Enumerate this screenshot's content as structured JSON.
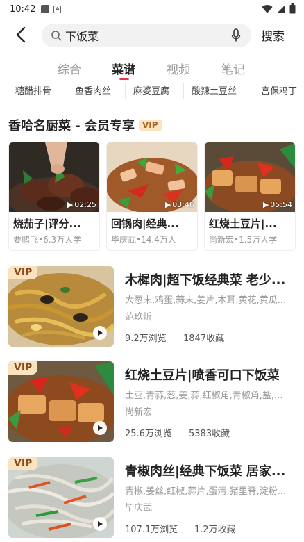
{
  "status_bar": {
    "time": "10:42",
    "icons": [
      "notification-icon",
      "a-icon",
      "wifi-icon",
      "signal-icon",
      "battery-icon"
    ]
  },
  "search": {
    "query": "下饭菜",
    "button_label": "搜索"
  },
  "tabs": [
    {
      "label": "综合",
      "active": false
    },
    {
      "label": "菜谱",
      "active": true
    },
    {
      "label": "视频",
      "active": false
    },
    {
      "label": "笔记",
      "active": false
    }
  ],
  "chips": [
    "糖醋排骨",
    "鱼香肉丝",
    "麻婆豆腐",
    "酸辣土豆丝",
    "宫保鸡丁"
  ],
  "vip_section": {
    "title": "香哈名厨菜 - 会员专享",
    "badge": "VIP",
    "cards": [
      {
        "title": "烧茄子|评分...",
        "author": "要鹏飞",
        "views": "6.3万人学",
        "duration": "02:25"
      },
      {
        "title": "回锅肉|经典...",
        "author": "毕庆武",
        "views": "14.4万人",
        "duration": "03:46"
      },
      {
        "title": "红烧土豆片|...",
        "author": "尚新宏",
        "views": "1.5万人学",
        "duration": "05:54"
      }
    ]
  },
  "recipes": [
    {
      "vip": "VIP",
      "title": "木樨肉|超下饭经典菜 老少...",
      "ingredients": "大葱末,鸡蛋,蒜末,姜片,木耳,黄花,黄瓜...",
      "author": "范玖炘",
      "views": "9.2万浏览",
      "favorites": "1847收藏"
    },
    {
      "vip": "VIP",
      "title": "红烧土豆片|喷香可口下饭菜",
      "ingredients": "土豆,青蒜,葱,姜,蒜,红椒角,青椒角,盐,...",
      "author": "尚新宏",
      "views": "25.6万浏览",
      "favorites": "5383收藏"
    },
    {
      "vip": "VIP",
      "title": "青椒肉丝|经典下饭菜 居家...",
      "ingredients": "青椒,姜丝,红椒,蒜片,蛋清,猪里脊,淀粉...",
      "author": "毕庆武",
      "views": "107.1万浏览",
      "favorites": "1.2万收藏"
    }
  ],
  "colors": {
    "accent": "#e8374b",
    "vip_bg": "#fbe3bf",
    "vip_text": "#a6632a"
  }
}
